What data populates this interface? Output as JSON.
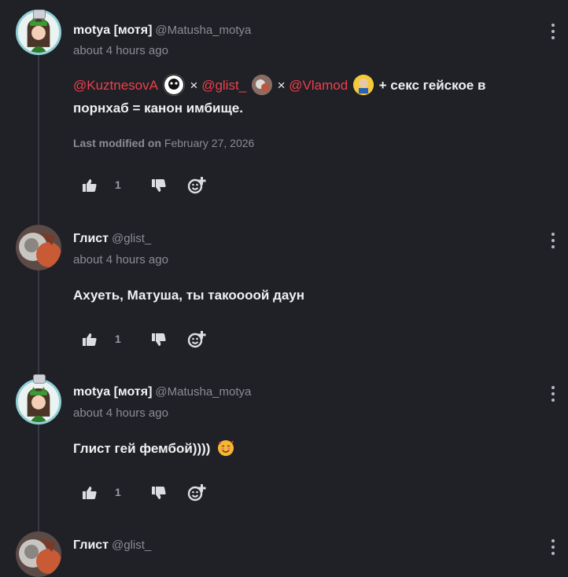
{
  "comments": [
    {
      "author": "motya [мотя]",
      "handle": "@Matusha_motya",
      "time": "about 4 hours ago",
      "body": {
        "m1": "@KuztnesovA",
        "x1": "×",
        "m2": "@glist_",
        "x2": "×",
        "m3": "@Vlamod",
        "rest1": "+ секс гейское в",
        "rest2": "порнхаб = канон имбище."
      },
      "modified_label": "Last modified on",
      "modified_date": "February 27, 2026",
      "likes": "1"
    },
    {
      "author": "Глист",
      "handle": "@glist_",
      "time": "about 4 hours ago",
      "body_text": "Ахуеть, Матуша, ты такоооой даун",
      "likes": "1"
    },
    {
      "author": "motya [мотя]",
      "handle": "@Matusha_motya",
      "time": "about 4 hours ago",
      "body_text": "Глист гей фембой))))",
      "emoji": "smiling-face-with-hearts",
      "likes": "1"
    },
    {
      "author": "Глист",
      "handle": "@glist_"
    }
  ],
  "icons": {
    "like": "thumbs-up-icon",
    "dislike": "thumbs-down-icon",
    "react": "add-reaction-icon",
    "menu": "more-vertical-icon"
  },
  "colors": {
    "background": "#202027",
    "mention": "#ef3f4a",
    "muted": "#8c8c96"
  }
}
